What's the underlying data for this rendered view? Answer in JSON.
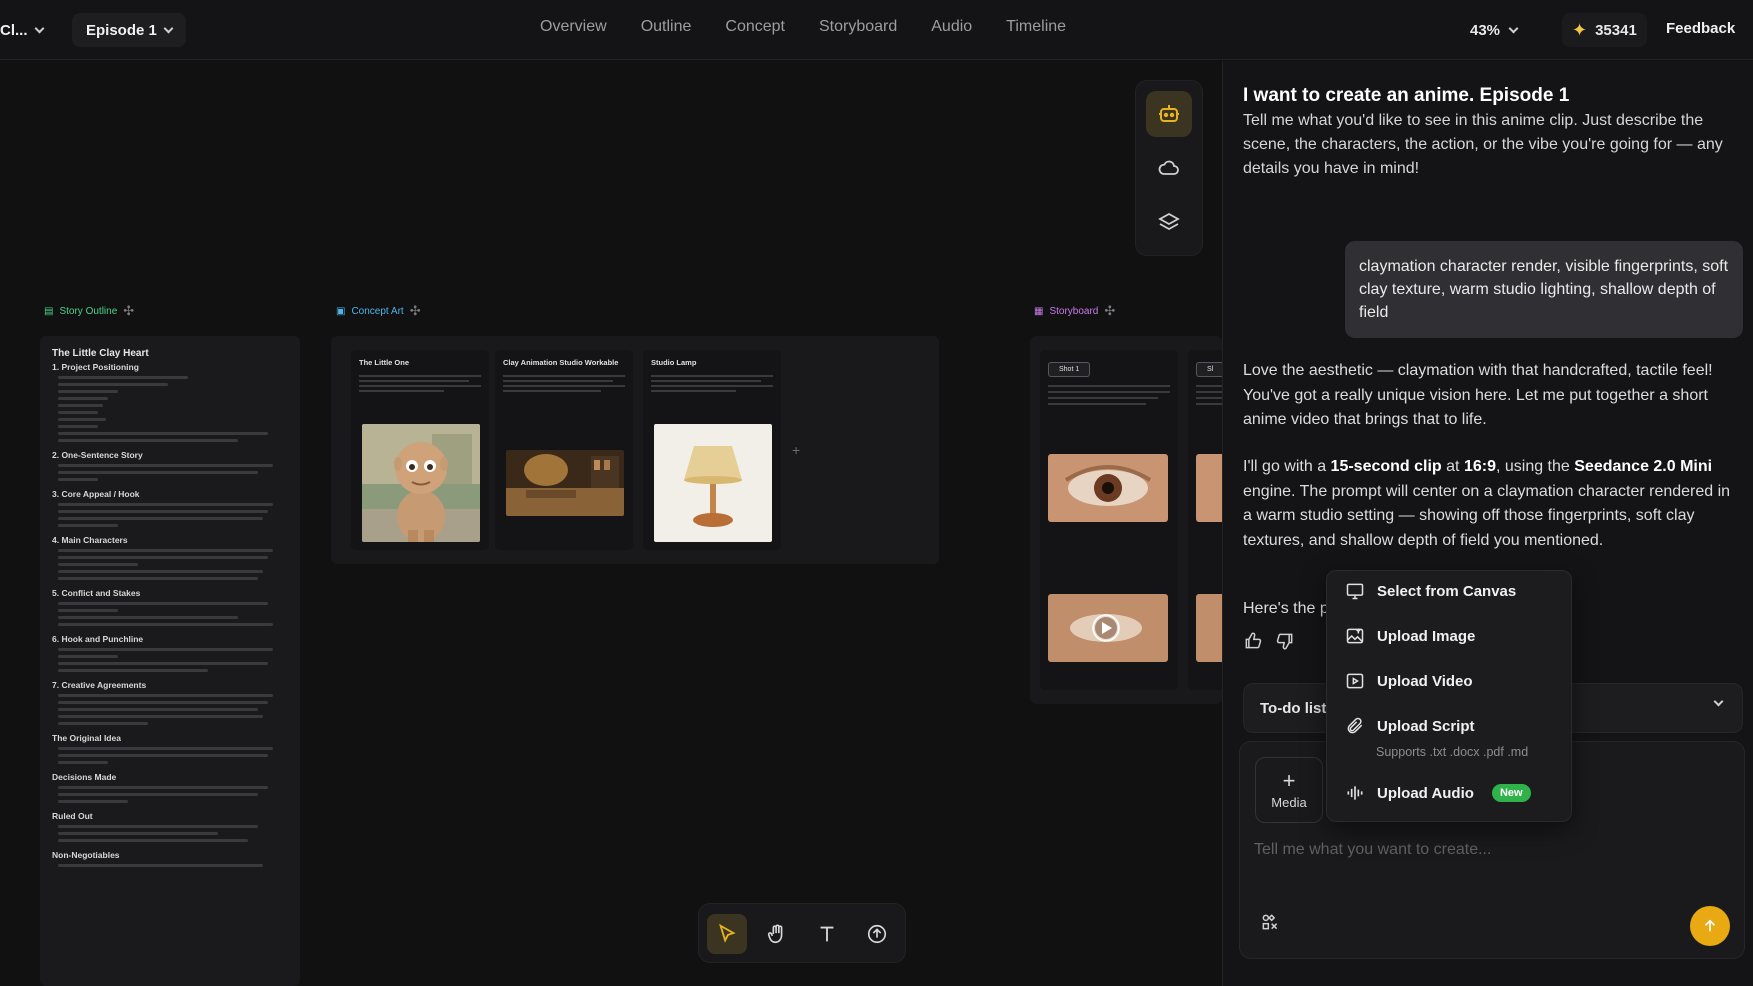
{
  "topbar": {
    "project_label": "Cl...",
    "episode_label": "Episode 1",
    "tabs": [
      "Overview",
      "Outline",
      "Concept",
      "Storyboard",
      "Audio",
      "Timeline"
    ],
    "zoom": "43%",
    "credits": "35341",
    "feedback": "Feedback"
  },
  "canvas": {
    "groups": {
      "outline": "Story Outline",
      "concept": "Concept Art",
      "storyboard": "Storyboard"
    },
    "outline": {
      "title": "The Little Clay Heart",
      "sections": [
        "1. Project Positioning",
        "2. One-Sentence Story",
        "3. Core Appeal / Hook",
        "4. Main Characters",
        "5. Conflict and Stakes",
        "6. Hook and Punchline",
        "7. Creative Agreements",
        "The Original Idea",
        "Decisions Made",
        "Ruled Out",
        "Non-Negotiables"
      ]
    },
    "concept_cards": [
      {
        "title": "The Little One"
      },
      {
        "title": "Clay Animation Studio Workable"
      },
      {
        "title": "Studio Lamp"
      }
    ],
    "shots": [
      {
        "tag": "Shot 1"
      },
      {
        "tag": "Sl"
      }
    ]
  },
  "chat": {
    "title": "I want to create an anime. Episode 1",
    "intro": "Tell me what you'd like to see in this anime clip. Just describe the scene, the characters, the action, or the vibe you're going for — any details you have in mind!",
    "user_message": "claymation character render, visible fingerprints, soft clay texture, warm studio lighting, shallow depth of field",
    "reply_1": "Love the aesthetic — claymation with that handcrafted, tactile feel! You've got a really unique vision here. Let me put together a short anime video that brings that to life.",
    "reply_2": {
      "pre": "I'll go with a ",
      "clip": "15-second clip",
      "mid": " at ",
      "ratio": "16:9",
      "mid2": ", using the ",
      "engine": "Seedance 2.0 Mini",
      "post": " engine. The prompt will center on a claymation character rendered in a warm studio setting — showing off those fingerprints, soft clay textures, and shallow depth of field you mentioned."
    },
    "reply_3": "Here's the p",
    "todo_label": "To-do list",
    "media_label": "Media",
    "input_placeholder": "Tell me what you want to create...",
    "accent_color": "#e8a912"
  },
  "popup": {
    "items": [
      {
        "label": "Select from Canvas",
        "icon": "monitor-icon"
      },
      {
        "label": "Upload Image",
        "icon": "image-upload-icon"
      },
      {
        "label": "Upload Video",
        "icon": "video-upload-icon"
      },
      {
        "label": "Upload Script",
        "icon": "paperclip-icon"
      },
      {
        "label": "Upload Audio",
        "icon": "audio-wave-icon"
      }
    ],
    "script_hint": "Supports .txt .docx .pdf .md",
    "new_badge": "New",
    "badge_color": "#2fb24a"
  }
}
